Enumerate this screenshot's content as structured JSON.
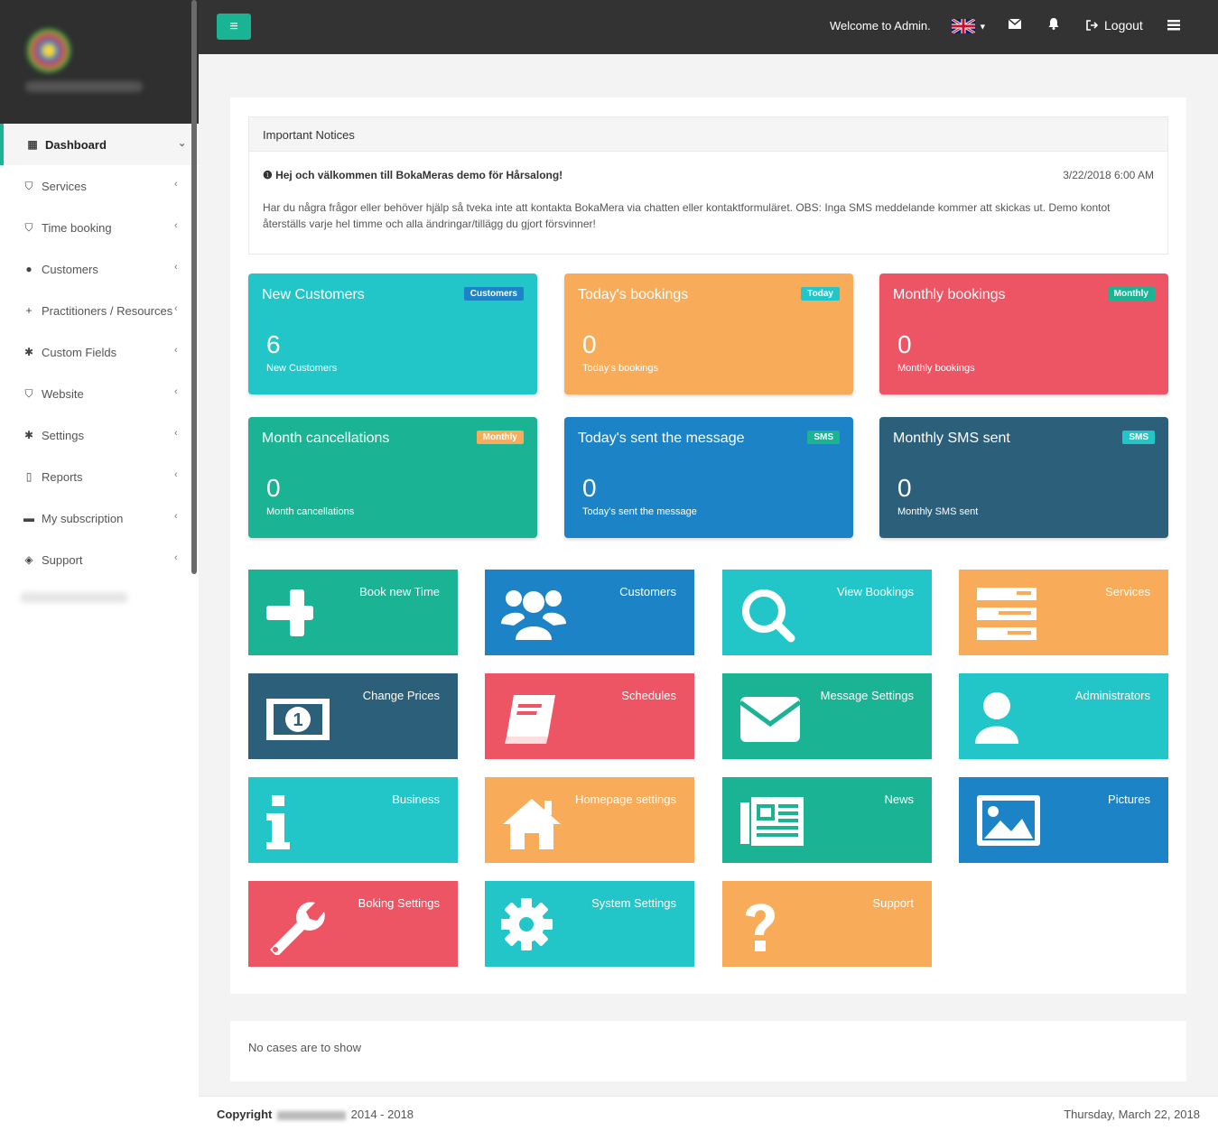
{
  "sidebar": {
    "items": [
      {
        "label": "Dashboard",
        "icon": "grid-icon",
        "glyph": "▦"
      },
      {
        "label": "Services",
        "icon": "shield-icon",
        "glyph": "⛉"
      },
      {
        "label": "Time booking",
        "icon": "shield-icon",
        "glyph": "⛉"
      },
      {
        "label": "Customers",
        "icon": "user-icon",
        "glyph": "●"
      },
      {
        "label": "Practitioners / Resources",
        "icon": "plus-icon",
        "glyph": "+"
      },
      {
        "label": "Custom Fields",
        "icon": "asterisk-icon",
        "glyph": "✱"
      },
      {
        "label": "Website",
        "icon": "shield-icon",
        "glyph": "⛉"
      },
      {
        "label": "Settings",
        "icon": "asterisk-icon",
        "glyph": "✱"
      },
      {
        "label": "Reports",
        "icon": "file-pdf-icon",
        "glyph": "▯"
      },
      {
        "label": "My subscription",
        "icon": "briefcase-icon",
        "glyph": "▬"
      },
      {
        "label": "Support",
        "icon": "ticket-icon",
        "glyph": "◈"
      }
    ]
  },
  "topbar": {
    "menu_glyph": "≡",
    "welcome": "Welcome to Admin.",
    "logout": "Logout"
  },
  "notice": {
    "header": "Important Notices",
    "title": "Hej och välkommen till BokaMeras demo för Hårsalong!",
    "date": "3/22/2018 6:00 AM",
    "body": "Har du några frågor eller behöver hjälp så tveka inte att kontakta BokaMera via chatten eller kontaktformuläret. OBS: Inga SMS meddelande kommer att skickas ut. Demo kontot återställs varje hel timme och alla ändringar/tillägg du gjort försvinner!"
  },
  "stats": [
    {
      "title": "New Customers",
      "badge": "Customers",
      "value": "6",
      "sub": "New Customers",
      "color": "#23c6c8",
      "badge_color": "#1c84c6"
    },
    {
      "title": "Today's bookings",
      "badge": "Today",
      "value": "0",
      "sub": "Today's bookings",
      "color": "#f8ac59",
      "badge_color": "#23c6c8"
    },
    {
      "title": "Monthly bookings",
      "badge": "Monthly",
      "value": "0",
      "sub": "Monthly bookings",
      "color": "#ed5565",
      "badge_color": "#1ab394"
    },
    {
      "title": "Month cancellations",
      "badge": "Monthly",
      "value": "0",
      "sub": "Month cancellations",
      "color": "#1ab394",
      "badge_color": "#f8ac59"
    },
    {
      "title": "Today's sent the message",
      "badge": "SMS",
      "value": "0",
      "sub": "Today's sent the message",
      "color": "#1c84c6",
      "badge_color": "#1ab394"
    },
    {
      "title": "Monthly SMS sent",
      "badge": "SMS",
      "value": "0",
      "sub": "Monthly SMS sent",
      "color": "#2b5f7a",
      "badge_color": "#23c6c8"
    }
  ],
  "tiles": [
    {
      "label": "Book new Time",
      "icon": "plus-icon",
      "color": "#1ab394"
    },
    {
      "label": "Customers",
      "icon": "users-icon",
      "color": "#1c84c6"
    },
    {
      "label": "View Bookings",
      "icon": "search-icon",
      "color": "#23c6c8"
    },
    {
      "label": "Services",
      "icon": "list-icon",
      "color": "#f8ac59"
    },
    {
      "label": "Change Prices",
      "icon": "money-icon",
      "color": "#2b5f7a"
    },
    {
      "label": "Schedules",
      "icon": "book-icon",
      "color": "#ed5565"
    },
    {
      "label": "Message Settings",
      "icon": "envelope-icon",
      "color": "#1ab394"
    },
    {
      "label": "Administrators",
      "icon": "user-icon",
      "color": "#23c6c8"
    },
    {
      "label": "Business",
      "icon": "info-icon",
      "color": "#23c6c8"
    },
    {
      "label": "Homepage settings",
      "icon": "home-icon",
      "color": "#f8ac59"
    },
    {
      "label": "News",
      "icon": "newspaper-icon",
      "color": "#1ab394"
    },
    {
      "label": "Pictures",
      "icon": "image-icon",
      "color": "#1c84c6"
    },
    {
      "label": "Boking Settings",
      "icon": "wrench-icon",
      "color": "#ed5565"
    },
    {
      "label": "System Settings",
      "icon": "gear-icon",
      "color": "#23c6c8"
    },
    {
      "label": "Support",
      "icon": "question-icon",
      "color": "#f8ac59"
    }
  ],
  "cases": {
    "text": "No cases are to show"
  },
  "footer": {
    "copyright_label": "Copyright",
    "years": "2014 - 2018",
    "date": "Thursday, March 22, 2018"
  }
}
